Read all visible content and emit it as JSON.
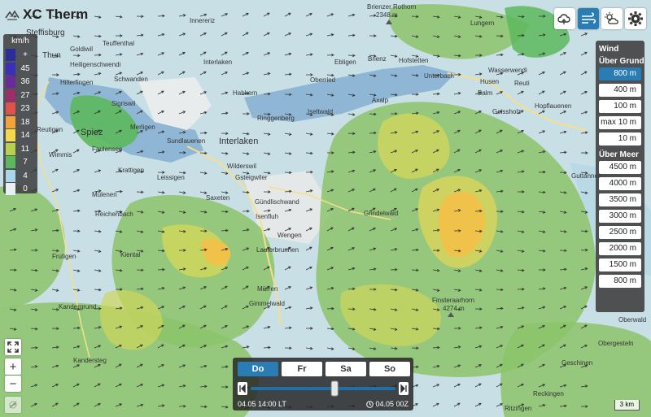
{
  "app": {
    "title": "XC Therm"
  },
  "legend": {
    "unit": "km/h",
    "items": [
      {
        "value": "+",
        "color": "#2b2d9a"
      },
      {
        "value": "45",
        "color": "#3a2fb8"
      },
      {
        "value": "36",
        "color": "#6a2a9c"
      },
      {
        "value": "27",
        "color": "#9e2e6a"
      },
      {
        "value": "23",
        "color": "#e0524a"
      },
      {
        "value": "18",
        "color": "#f4a23a"
      },
      {
        "value": "14",
        "color": "#f2d84a"
      },
      {
        "value": "11",
        "color": "#b6d24a"
      },
      {
        "value": "7",
        "color": "#5cb85c"
      },
      {
        "value": "4",
        "color": "#a9d6ea"
      },
      {
        "value": "0",
        "color": "#e8eef2"
      }
    ]
  },
  "toolbar": {
    "buttons": [
      {
        "name": "thermal-icon",
        "active": false
      },
      {
        "name": "wind-icon",
        "active": true
      },
      {
        "name": "weather-icon",
        "active": false
      },
      {
        "name": "gear-icon",
        "active": false
      }
    ]
  },
  "level_panel": {
    "title": "Wind",
    "ground_label": "Über Grund",
    "ground_levels": [
      "800 m",
      "400 m",
      "100 m",
      "max 10 m",
      "10 m"
    ],
    "sea_label": "Über Meer",
    "sea_levels": [
      "4500 m",
      "4000 m",
      "3500 m",
      "3000 m",
      "2500 m",
      "2000 m",
      "1500 m",
      "800 m"
    ],
    "active": "800 m"
  },
  "timebar": {
    "days": [
      "Do",
      "Fr",
      "Sa",
      "So"
    ],
    "active_day": "Do",
    "local_time": "04.05 14:00 LT",
    "utc_time": "04.05 00Z",
    "slider_position": 0.58
  },
  "scale": "3 km",
  "places": [
    {
      "name": "Steffisburg"
    },
    {
      "name": "Thun"
    },
    {
      "name": "Goldiwil"
    },
    {
      "name": "Heiligenschwendi"
    },
    {
      "name": "Teuffenthal"
    },
    {
      "name": "Schwanden"
    },
    {
      "name": "Hilterfingen"
    },
    {
      "name": "Sigriswil"
    },
    {
      "name": "Habkern"
    },
    {
      "name": "Spiez"
    },
    {
      "name": "Merligen"
    },
    {
      "name": "Sundlauenen"
    },
    {
      "name": "Faulensee"
    },
    {
      "name": "Reutigen"
    },
    {
      "name": "Wimmis"
    },
    {
      "name": "Krattigen"
    },
    {
      "name": "Leissigen"
    },
    {
      "name": "Interlaken"
    },
    {
      "name": "Ringgenberg"
    },
    {
      "name": "Wilderswil"
    },
    {
      "name": "Gsteigwiler"
    },
    {
      "name": "Saxeten"
    },
    {
      "name": "Gündlischwand"
    },
    {
      "name": "Isenfluh"
    },
    {
      "name": "Grindelwald"
    },
    {
      "name": "Mülenen"
    },
    {
      "name": "Reichenbach"
    },
    {
      "name": "Frutigen"
    },
    {
      "name": "Kiental"
    },
    {
      "name": "Wengen"
    },
    {
      "name": "Lauterbrunnen"
    },
    {
      "name": "Mürren"
    },
    {
      "name": "Gimmelwald"
    },
    {
      "name": "Kandergrund"
    },
    {
      "name": "Kandersteg"
    },
    {
      "name": "Brienzer Rothorn"
    },
    {
      "name": "2348 m"
    },
    {
      "name": "Brienz"
    },
    {
      "name": "Ebligen"
    },
    {
      "name": "Oberried"
    },
    {
      "name": "Iseltwald"
    },
    {
      "name": "Hofstetten"
    },
    {
      "name": "Unterbach"
    },
    {
      "name": "Husen"
    },
    {
      "name": "Balm"
    },
    {
      "name": "Axalp"
    },
    {
      "name": "Wasserwendi"
    },
    {
      "name": "Reuti"
    },
    {
      "name": "Geissholz"
    },
    {
      "name": "Hopflauenen"
    },
    {
      "name": "Guttannen"
    },
    {
      "name": "Lungern"
    },
    {
      "name": "Interlaken"
    },
    {
      "name": "Innereriz"
    },
    {
      "name": "Finsteraarhorn"
    },
    {
      "name": "4274 m"
    },
    {
      "name": "Oberwald"
    },
    {
      "name": "Obergesteln"
    },
    {
      "name": "Geschinen"
    },
    {
      "name": "Reckingen"
    },
    {
      "name": "Ritzingen"
    }
  ]
}
